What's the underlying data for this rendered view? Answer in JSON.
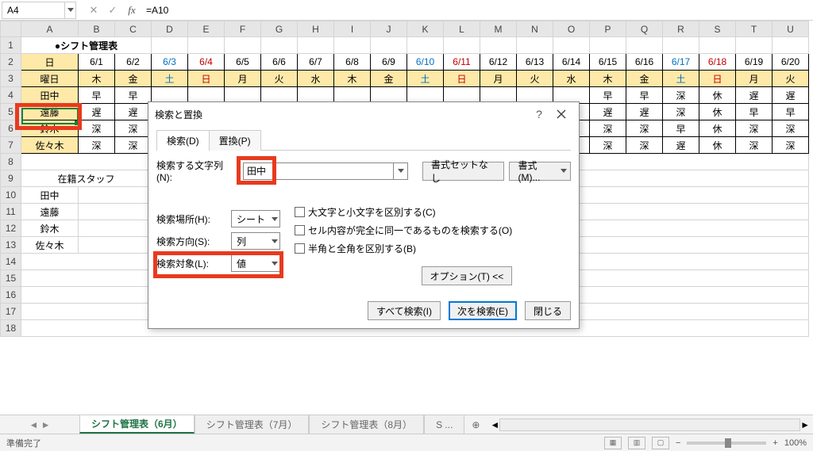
{
  "formula_bar": {
    "name_box": "A4",
    "formula": "=A10",
    "fx": "fx"
  },
  "columns": [
    "A",
    "B",
    "C",
    "D",
    "E",
    "F",
    "G",
    "H",
    "I",
    "J",
    "K",
    "L",
    "M",
    "N",
    "O",
    "P",
    "Q",
    "R",
    "S",
    "T",
    "U"
  ],
  "title_cell": "●シフト管理表",
  "dates": {
    "row2_label": "日",
    "values": [
      "6/1",
      "6/2",
      "6/3",
      "6/4",
      "6/5",
      "6/6",
      "6/7",
      "6/8",
      "6/9",
      "6/10",
      "6/11",
      "6/12",
      "6/13",
      "6/14",
      "6/15",
      "6/16",
      "6/17",
      "6/18",
      "6/19",
      "6/20"
    ],
    "classes": [
      "",
      "",
      "sat",
      "sun",
      "",
      "",
      "",
      "",
      "",
      "sat",
      "sun",
      "",
      "",
      "",
      "",
      "",
      "sat",
      "sun",
      "",
      ""
    ]
  },
  "weekdays": {
    "row3_label": "曜日",
    "values": [
      "木",
      "金",
      "土",
      "日",
      "月",
      "火",
      "水",
      "木",
      "金",
      "土",
      "日",
      "月",
      "火",
      "水",
      "木",
      "金",
      "土",
      "日",
      "月",
      "火"
    ]
  },
  "staff_rows": [
    {
      "name": "田中",
      "shifts": [
        "早",
        "早",
        "",
        "",
        "",
        "",
        "",
        "",
        "",
        "",
        "",
        "",
        "",
        "",
        "早",
        "早",
        "深",
        "休",
        "遅",
        "遅"
      ]
    },
    {
      "name": "遠藤",
      "shifts": [
        "遅",
        "遅",
        "",
        "",
        "",
        "",
        "",
        "",
        "",
        "",
        "",
        "",
        "",
        "",
        "遅",
        "遅",
        "深",
        "休",
        "早",
        "早"
      ]
    },
    {
      "name": "鈴木",
      "shifts": [
        "深",
        "深",
        "",
        "",
        "",
        "",
        "",
        "",
        "",
        "",
        "",
        "",
        "",
        "",
        "深",
        "深",
        "早",
        "休",
        "深",
        "深"
      ]
    },
    {
      "name": "佐々木",
      "shifts": [
        "深",
        "深",
        "",
        "",
        "",
        "",
        "",
        "",
        "",
        "",
        "",
        "",
        "",
        "",
        "深",
        "深",
        "遅",
        "休",
        "深",
        "深"
      ]
    }
  ],
  "staff_list_header": "在籍スタッフ",
  "staff_list": [
    "田中",
    "遠藤",
    "鈴木",
    "佐々木"
  ],
  "dialog": {
    "title": "検索と置換",
    "tab_find": "検索(D)",
    "tab_replace": "置換(P)",
    "label_findwhat": "検索する文字列(N):",
    "find_value": "田中",
    "btn_noformat": "書式セットなし",
    "btn_format": "書式(M)...",
    "label_within": "検索場所(H):",
    "within_value": "シート",
    "label_searchdir": "検索方向(S):",
    "searchdir_value": "列",
    "label_lookin": "検索対象(L):",
    "lookin_value": "値",
    "chk_case": "大文字と小文字を区別する(C)",
    "chk_whole": "セル内容が完全に同一であるものを検索する(O)",
    "chk_width": "半角と全角を区別する(B)",
    "btn_options": "オプション(T) <<",
    "btn_findall": "すべて検索(I)",
    "btn_findnext": "次を検索(E)",
    "btn_close": "閉じる"
  },
  "tabs": {
    "active": "シフト管理表（6月）",
    "others": [
      "シフト管理表（7月）",
      "シフト管理表（8月）",
      "S ..."
    ]
  },
  "status": {
    "ready": "準備完了",
    "zoom": "100%"
  }
}
